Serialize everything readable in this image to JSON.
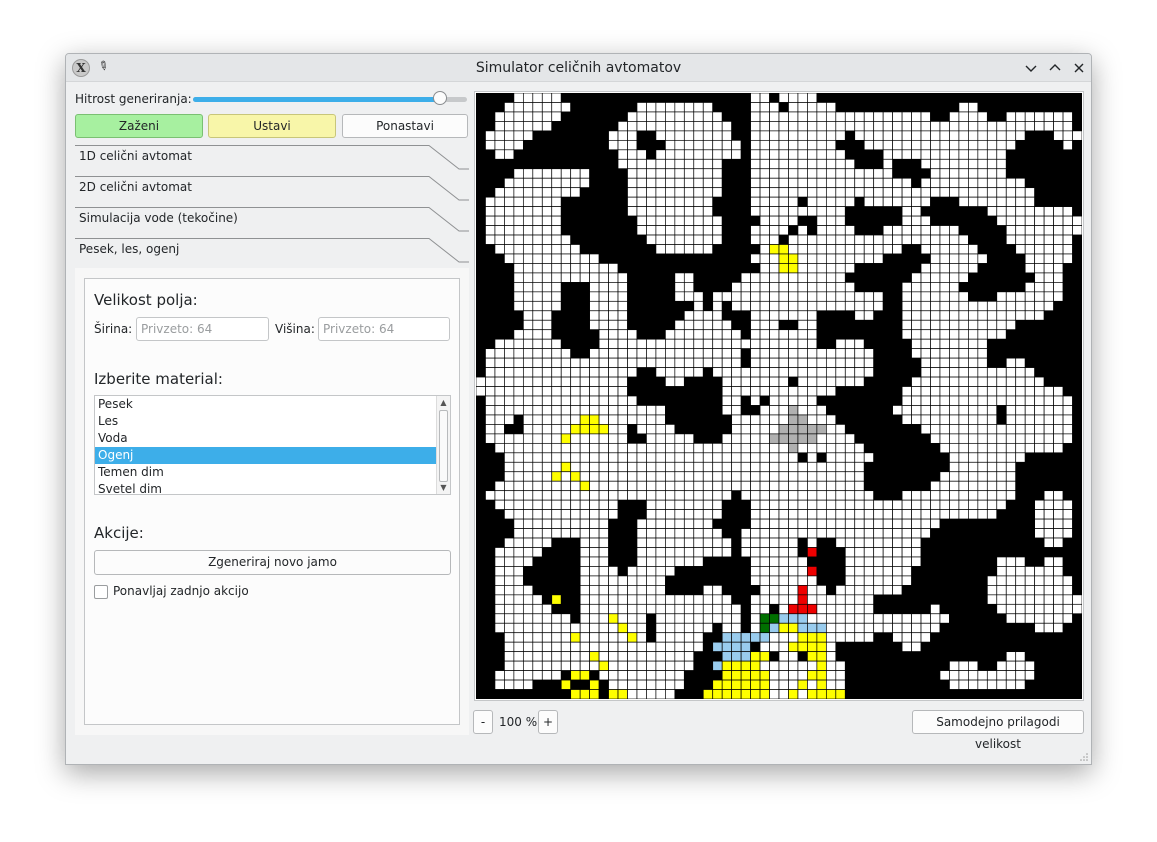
{
  "window": {
    "title": "Simulator celičnih avtomatov"
  },
  "speed": {
    "label": "Hitrost generiranja:",
    "value_fraction": 0.9
  },
  "controls": {
    "run": "Zaženi",
    "stop": "Ustavi",
    "reset": "Ponastavi"
  },
  "tabs": [
    {
      "label": "1D celični avtomat"
    },
    {
      "label": "2D celični avtomat"
    },
    {
      "label": "Simulacija vode (tekočine)"
    },
    {
      "label": "Pesek, les, ogenj"
    }
  ],
  "panel": {
    "size_title": "Velikost polja:",
    "width_label": "Širina:",
    "width_placeholder": "Privzeto: 64",
    "height_label": "Višina:",
    "height_placeholder": "Privzeto: 64",
    "material_title": "Izberite material:",
    "materials": [
      "Pesek",
      "Les",
      "Voda",
      "Ogenj",
      "Temen dim",
      "Svetel dim"
    ],
    "selected_material": "Ogenj",
    "actions_title": "Akcije:",
    "generate_button": "Zgeneriraj novo jamo",
    "repeat_label": "Ponavljaj zadnjo akcijo",
    "repeat_checked": false
  },
  "zoom": {
    "minus": "-",
    "value": "100 %",
    "plus": "+"
  },
  "autofit_button": "Samodejno prilagodi velikost",
  "grid_info": {
    "columns": 64,
    "rows": 64,
    "colors": {
      "wall": "#000000",
      "empty": "#ffffff",
      "sand": "#ffff00",
      "wood": "#007000",
      "water": "#99ccee",
      "fire": "#ee0000",
      "smoke": "#b0b0b0"
    }
  },
  "icons": {
    "app": "x-logo-icon",
    "pin": "pin-icon",
    "minimize": "chevron-down-icon",
    "maximize": "chevron-up-icon",
    "close": "close-icon"
  }
}
